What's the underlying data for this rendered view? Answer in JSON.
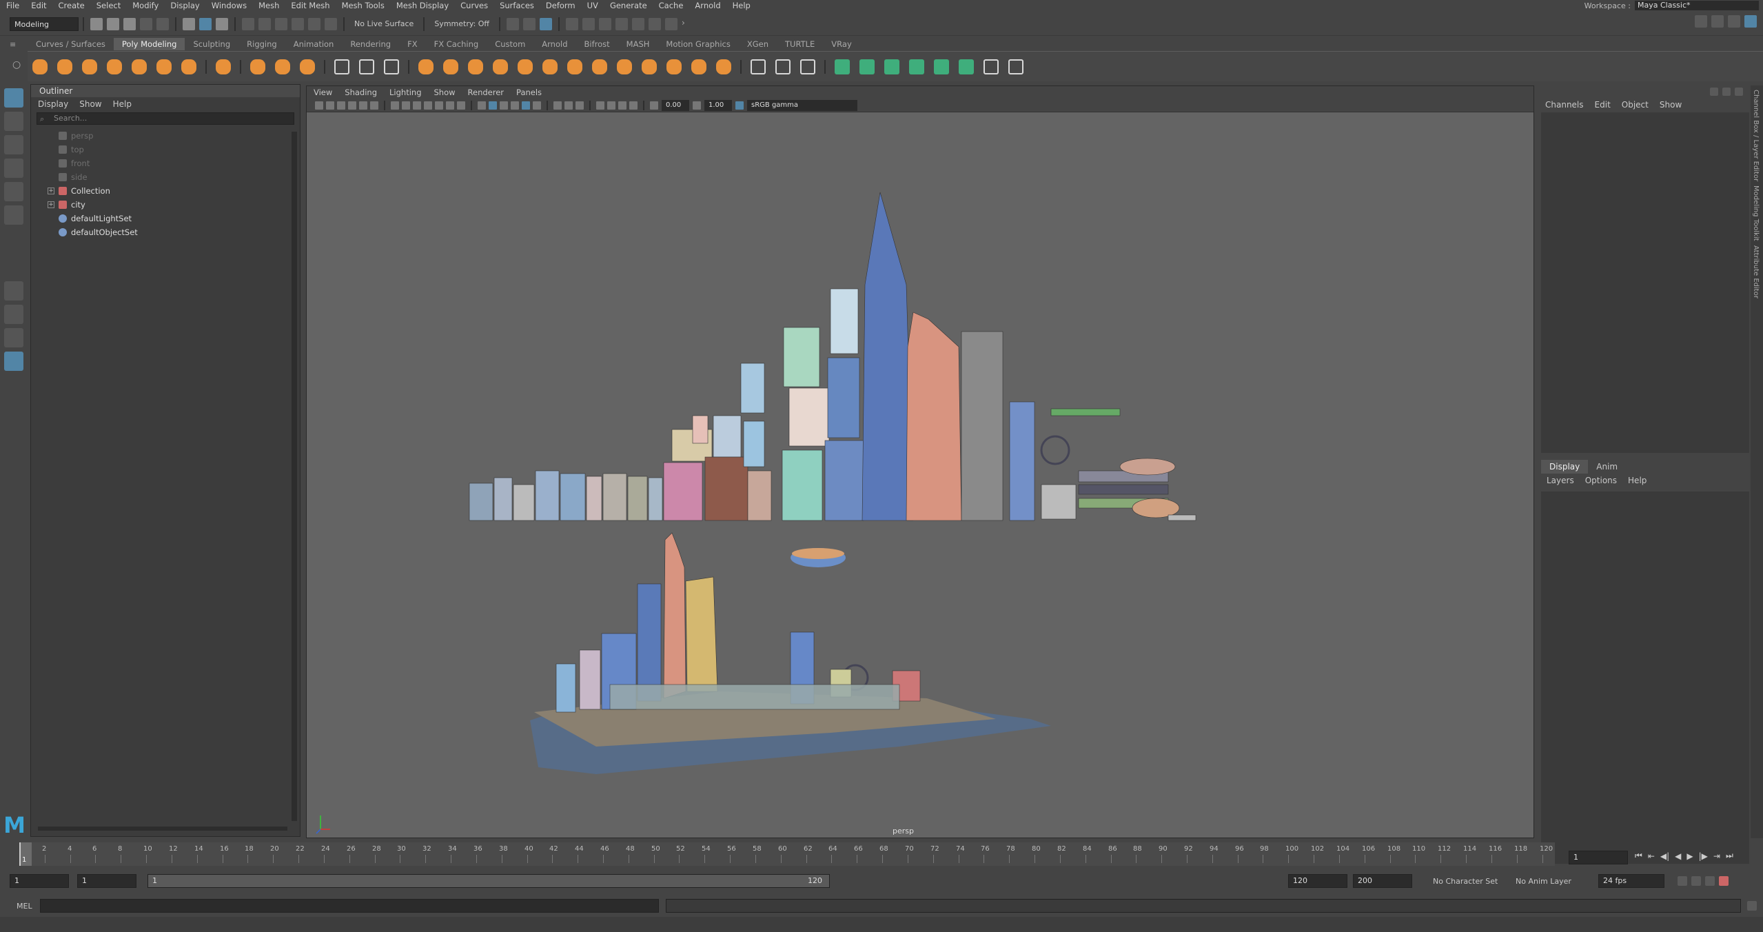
{
  "menubar": {
    "items": [
      "File",
      "Edit",
      "Create",
      "Select",
      "Modify",
      "Display",
      "Windows",
      "Mesh",
      "Edit Mesh",
      "Mesh Tools",
      "Mesh Display",
      "Curves",
      "Surfaces",
      "Deform",
      "UV",
      "Generate",
      "Cache",
      "Arnold",
      "Help"
    ],
    "workspace_label": "Workspace :",
    "workspace_value": "Maya Classic*"
  },
  "statusline": {
    "mode": "Modeling",
    "live_surface": "No Live Surface",
    "symmetry": "Symmetry: Off"
  },
  "shelf": {
    "tabs": [
      "Curves / Surfaces",
      "Poly Modeling",
      "Sculpting",
      "Rigging",
      "Animation",
      "Rendering",
      "FX",
      "FX Caching",
      "Custom",
      "Arnold",
      "Bifrost",
      "MASH",
      "Motion Graphics",
      "XGen",
      "TURTLE",
      "VRay"
    ],
    "active_tab": "Poly Modeling",
    "orange_icons": 12,
    "colors": {
      "orange": "#e8913a",
      "green": "#3fae7c",
      "white": "#d8d8d8"
    }
  },
  "outliner": {
    "title": "Outliner",
    "menu": [
      "Display",
      "Show",
      "Help"
    ],
    "search_placeholder": "Search...",
    "nodes": [
      {
        "label": "persp",
        "dim": true,
        "icon": "camera-icon"
      },
      {
        "label": "top",
        "dim": true,
        "icon": "camera-icon"
      },
      {
        "label": "front",
        "dim": true,
        "icon": "camera-icon"
      },
      {
        "label": "side",
        "dim": true,
        "icon": "camera-icon"
      },
      {
        "label": "Collection",
        "dim": false,
        "icon": "group-icon",
        "expandable": true
      },
      {
        "label": "city",
        "dim": false,
        "icon": "group-icon",
        "expandable": true
      },
      {
        "label": "defaultLightSet",
        "dim": false,
        "icon": "set-icon"
      },
      {
        "label": "defaultObjectSet",
        "dim": false,
        "icon": "set-icon"
      }
    ]
  },
  "viewport": {
    "menu": [
      "View",
      "Shading",
      "Lighting",
      "Show",
      "Renderer",
      "Panels"
    ],
    "exposure": "0.00",
    "gamma": "1.00",
    "color_space": "sRGB gamma",
    "camera_label": "persp",
    "bg_color": "#646464"
  },
  "channelbox": {
    "menu": [
      "Channels",
      "Edit",
      "Object",
      "Show"
    ],
    "layer_tabs": [
      "Display",
      "Anim"
    ],
    "layer_menu": [
      "Layers",
      "Options",
      "Help"
    ],
    "side_tabs": [
      "Channel Box / Layer Editor",
      "Modeling Toolkit",
      "Attribute Editor"
    ]
  },
  "timeline": {
    "ticks": [
      "2",
      "4",
      "6",
      "8",
      "10",
      "12",
      "14",
      "16",
      "18",
      "20",
      "22",
      "24",
      "26",
      "28",
      "30",
      "32",
      "34",
      "36",
      "38",
      "40",
      "42",
      "44",
      "46",
      "48",
      "50",
      "52",
      "54",
      "56",
      "58",
      "60",
      "62",
      "64",
      "66",
      "68",
      "70",
      "72",
      "74",
      "76",
      "78",
      "80",
      "82",
      "84",
      "86",
      "88",
      "90",
      "92",
      "94",
      "96",
      "98",
      "100",
      "102",
      "104",
      "106",
      "108",
      "110",
      "112",
      "114",
      "116",
      "118",
      "120"
    ],
    "current_frame": "1",
    "frame_field": "1"
  },
  "range": {
    "start": "1",
    "playback_start": "1",
    "slider_start": "1",
    "slider_end": "120",
    "playback_end": "120",
    "end": "200",
    "character_set": "No Character Set",
    "anim_layer": "No Anim Layer",
    "fps": "24 fps"
  },
  "cmdline": {
    "label": "MEL"
  },
  "logo": "M"
}
